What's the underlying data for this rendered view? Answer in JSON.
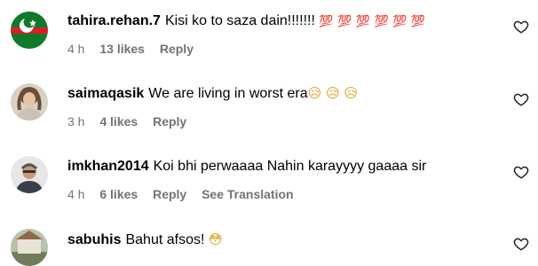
{
  "comments": [
    {
      "username": "tahira.rehan.7",
      "text": "Kisi ko to saza dain!!!!!!!",
      "emoji": "💯 💯 💯 💯 💯 💯",
      "time": "4 h",
      "likes": "13 likes",
      "reply": "Reply",
      "extra": "",
      "avatar_icon": "pti-flag-avatar"
    },
    {
      "username": "saimaqasik",
      "text": "We are living in worst era",
      "emoji": "😥 😥 😥",
      "time": "3 h",
      "likes": "4 likes",
      "reply": "Reply",
      "extra": "",
      "avatar_icon": "photo-avatar"
    },
    {
      "username": "imkhan2014",
      "text": "Koi bhi perwaaaa Nahin karayyyy gaaaa sir",
      "emoji": "",
      "time": "4 h",
      "likes": "6 likes",
      "reply": "Reply",
      "extra": "See Translation",
      "avatar_icon": "photo-avatar"
    },
    {
      "username": "sabuhis",
      "text": "Bahut afsos!",
      "emoji": "😳",
      "time": "",
      "likes": "",
      "reply": "",
      "extra": "",
      "avatar_icon": "photo-avatar"
    }
  ],
  "colors": {
    "meta_gray": "#737373",
    "pti_green": "#0f7a2a",
    "pti_red": "#d71e26",
    "emoji_red": "#e0245e"
  }
}
